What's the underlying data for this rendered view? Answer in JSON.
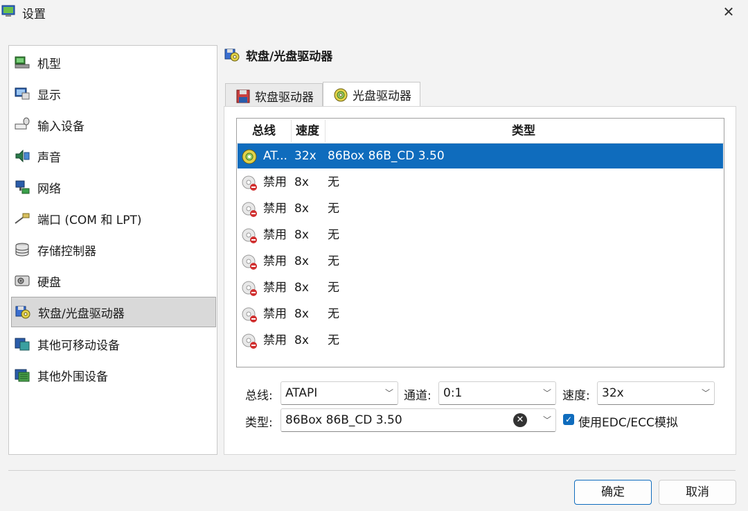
{
  "window": {
    "title": "设置",
    "close_glyph": "✕"
  },
  "sidebar": {
    "items": [
      {
        "label": "机型",
        "icon": "machine-icon"
      },
      {
        "label": "显示",
        "icon": "display-icon"
      },
      {
        "label": "输入设备",
        "icon": "input-devices-icon"
      },
      {
        "label": "声音",
        "icon": "sound-icon"
      },
      {
        "label": "网络",
        "icon": "network-icon"
      },
      {
        "label": "端口 (COM 和 LPT)",
        "icon": "ports-icon"
      },
      {
        "label": "存储控制器",
        "icon": "storage-controllers-icon"
      },
      {
        "label": "硬盘",
        "icon": "hard-disk-icon"
      },
      {
        "label": "软盘/光盘驱动器",
        "icon": "floppy-cdrom-icon"
      },
      {
        "label": "其他可移动设备",
        "icon": "removable-devices-icon"
      },
      {
        "label": "其他外围设备",
        "icon": "peripherals-icon"
      }
    ],
    "selected_index": 8
  },
  "page": {
    "heading": "软盘/光盘驱动器"
  },
  "tabs": [
    {
      "label": "软盘驱动器",
      "icon": "floppy-icon"
    },
    {
      "label": "光盘驱动器",
      "icon": "cdrom-icon"
    }
  ],
  "table": {
    "headers": {
      "bus": "总线",
      "speed": "速度",
      "type": "类型"
    },
    "rows": [
      {
        "bus": "AT...",
        "speed": "32x",
        "type": "86Box 86B_CD 3.50",
        "enabled": true,
        "selected": true
      },
      {
        "bus": "禁用",
        "speed": "8x",
        "type": "无",
        "enabled": false
      },
      {
        "bus": "禁用",
        "speed": "8x",
        "type": "无",
        "enabled": false
      },
      {
        "bus": "禁用",
        "speed": "8x",
        "type": "无",
        "enabled": false
      },
      {
        "bus": "禁用",
        "speed": "8x",
        "type": "无",
        "enabled": false
      },
      {
        "bus": "禁用",
        "speed": "8x",
        "type": "无",
        "enabled": false
      },
      {
        "bus": "禁用",
        "speed": "8x",
        "type": "无",
        "enabled": false
      },
      {
        "bus": "禁用",
        "speed": "8x",
        "type": "无",
        "enabled": false
      }
    ]
  },
  "form": {
    "bus_label": "总线:",
    "bus_value": "ATAPI",
    "channel_label": "通道:",
    "channel_value": "0:1",
    "speed_label": "速度:",
    "speed_value": "32x",
    "type_label": "类型:",
    "type_value": "86Box 86B_CD 3.50",
    "edc_label": "使用EDC/ECC模拟",
    "edc_checked": true,
    "chevron": "﹀",
    "clear_glyph": "✕",
    "check_glyph": "✓"
  },
  "buttons": {
    "ok": "确定",
    "cancel": "取消"
  },
  "colors": {
    "selection": "#0f6cbd",
    "accent": "#0f6cbd"
  }
}
